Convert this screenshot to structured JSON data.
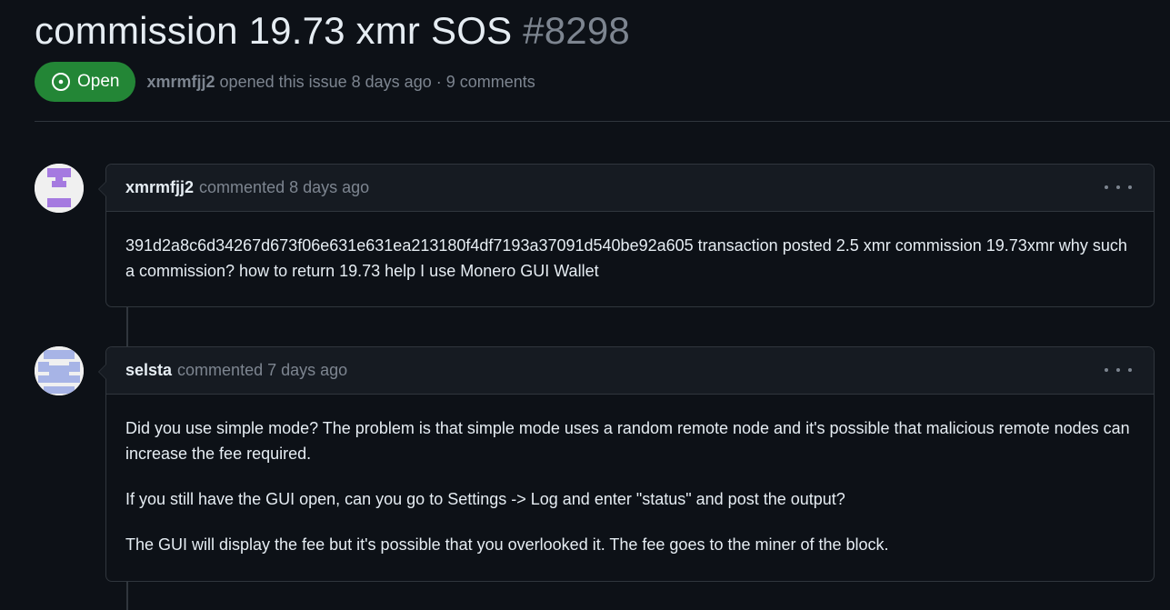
{
  "issue": {
    "title": "commission 19.73 xmr SOS",
    "number": "#8298",
    "state": "Open",
    "author": "xmrmfjj2",
    "meta_text": "opened this issue 8 days ago · 9 comments",
    "colors": {
      "background": "#0d1117",
      "open_badge": "#238636",
      "border": "#30363d",
      "header_bg": "#161b22",
      "muted": "#7d8590"
    }
  },
  "comments": [
    {
      "author": "xmrmfjj2",
      "action": "commented 8 days ago",
      "avatar_icon": "identicon-purple",
      "avatar_color": "#a57ae0",
      "body": [
        "391d2a8c6d34267d673f06e631e631ea213180f4df7193a37091d540be92a605 transaction posted 2.5 xmr commission 19.73xmr why such a commission? how to return 19.73 help I use Monero GUI Wallet"
      ]
    },
    {
      "author": "selsta",
      "action": "commented 7 days ago",
      "avatar_icon": "identicon-blue",
      "avatar_color": "#a7b4e6",
      "body": [
        "Did you use simple mode? The problem is that simple mode uses a random remote node and it's possible that malicious remote nodes can increase the fee required.",
        "If you still have the GUI open, can you go to Settings -> Log and enter \"status\" and post the output?",
        "The GUI will display the fee but it's possible that you overlooked it. The fee goes to the miner of the block."
      ]
    }
  ]
}
